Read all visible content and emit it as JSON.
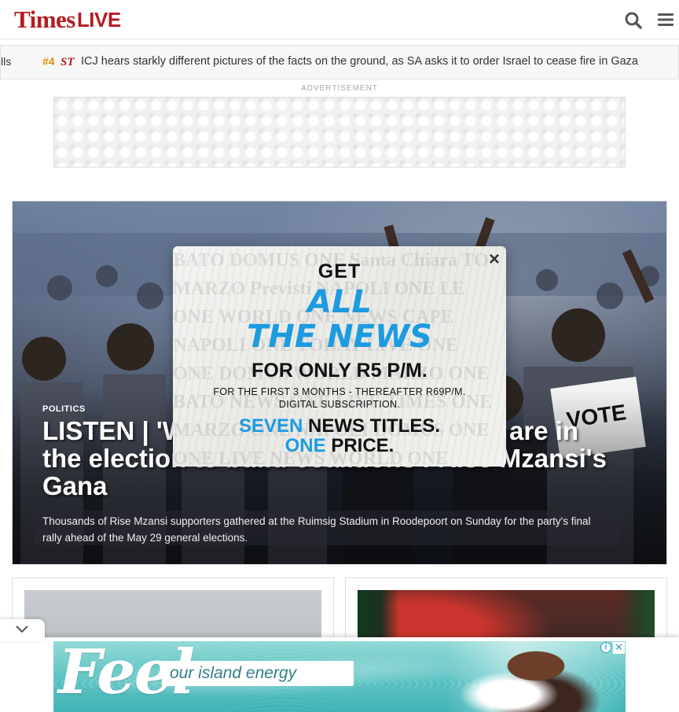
{
  "header": {
    "logo_times": "Times",
    "logo_live": "LIVE",
    "search_icon": "search-icon",
    "menu_icon": "hamburger-menu-icon"
  },
  "ticker": {
    "prev_fragment": "lls",
    "rank": "#4",
    "badge": "ST",
    "headline": "ICJ hears starkly different pictures of the facts on the ground, as SA asks it to order Israel to cease fire in Gaza"
  },
  "ad_top": {
    "label": "ADVERTISEMENT"
  },
  "hero": {
    "category": "POLITICS",
    "title": "LISTEN | 'We are going to win and we are in the election to build coalitions': Rise Mzansi's Gana",
    "description": "Thousands of Rise Mzansi supporters gathered at the Ruimsig Stadium in Roodepoort on Sunday for the party's final rally ahead of the May 29 general elections."
  },
  "popup": {
    "close": "×",
    "get": "GET",
    "all": "ALL",
    "the_news": "THE NEWS",
    "price": "FOR ONLY R5 P/M.",
    "fine1": "FOR THE FIRST 3 MONTHS - THEREAFTER R69P/M.",
    "fine2": "DIGITAL SUBSCRIPTION.",
    "seven": "SEVEN",
    "news_titles": "NEWS TITLES.",
    "one": "ONE",
    "price_word": "PRICE.",
    "accent_color": "#1d9be0"
  },
  "bottom_ad": {
    "feel": "Feel",
    "tagline": "our island energy",
    "info": "i",
    "close": "✕"
  }
}
